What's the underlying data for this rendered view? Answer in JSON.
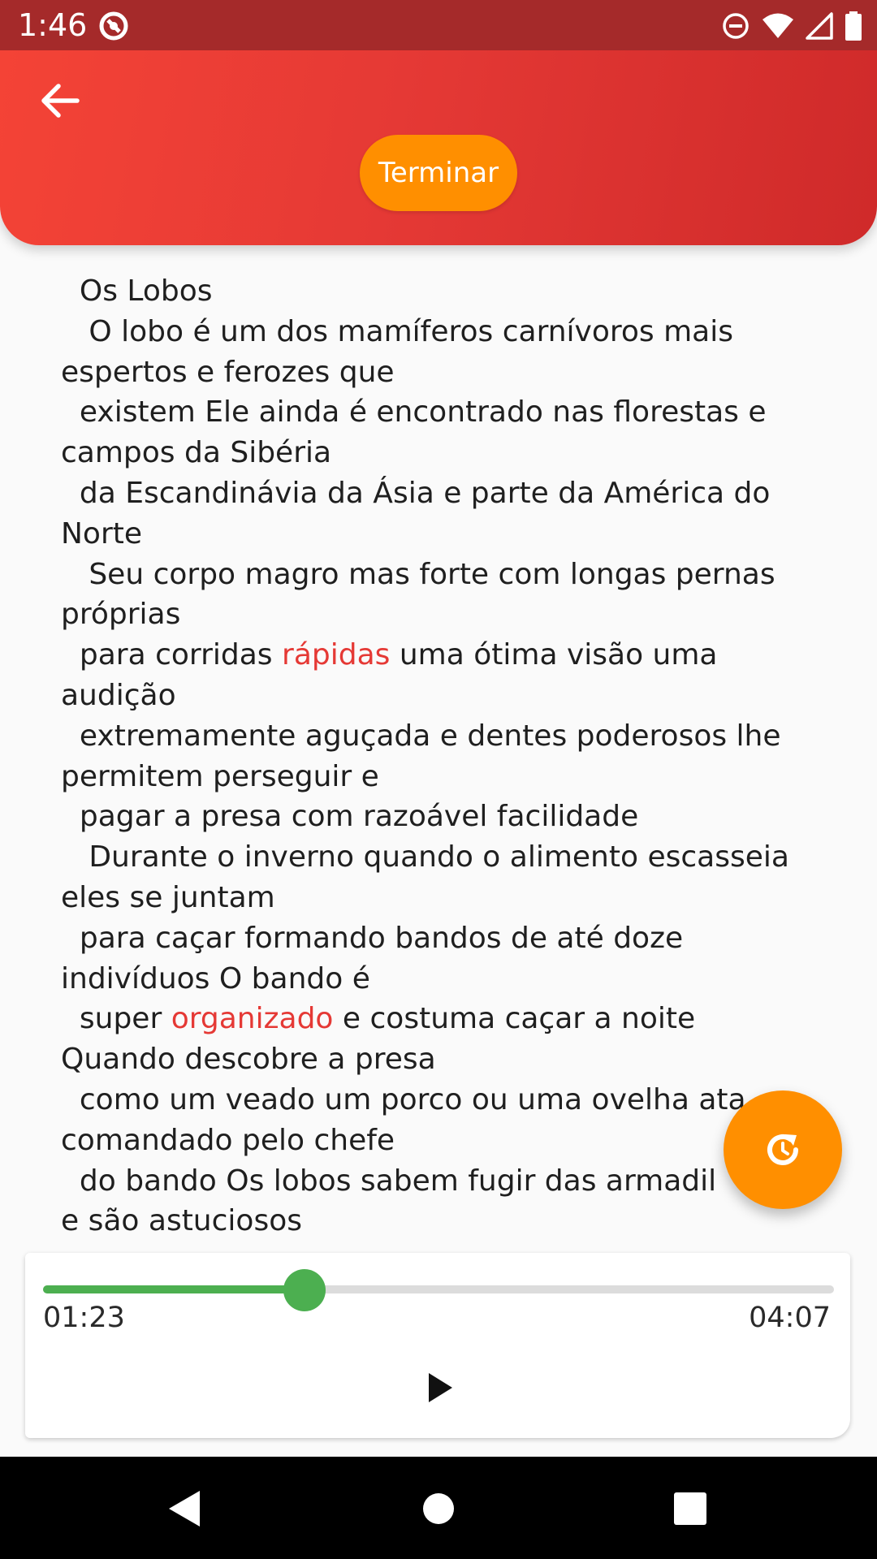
{
  "status_bar": {
    "time": "1:46",
    "background": "#a52a2a",
    "icons": [
      "app-notification-icon",
      "do-not-disturb-icon",
      "wifi-icon",
      "signal-icon",
      "battery-icon"
    ]
  },
  "app_bar": {
    "back_icon": "arrow-left-icon",
    "finish_label": "Terminar",
    "gradient": [
      "#f44336",
      "#cf2a2a"
    ],
    "finish_color": "#ff8f00"
  },
  "story": {
    "highlight_color": "#e53935",
    "lines": [
      "  Os Lobos",
      "   O lobo é um dos mamíferos carnívoros mais",
      "espertos e ferozes que",
      "  existem Ele ainda é encontrado nas florestas e",
      "campos da Sibéria",
      "  da Escandinávia da Ásia e parte da América do",
      "Norte",
      "   Seu corpo magro mas forte com longas pernas",
      "próprias",
      "  para corridas |rápidas| uma ótima visão uma",
      "audição",
      "  extremamente aguçada e dentes poderosos lhe",
      "permitem perseguir e",
      "  pagar a presa com razoável facilidade",
      "   Durante o inverno quando o alimento escasseia",
      "eles se juntam",
      "  para caçar formando bandos de até doze",
      "indivíduos O bando é",
      "  super |organizado| e costuma caçar a noite",
      "Quando descobre a presa",
      "  como um veado um porco ou uma ovelha ata",
      "comandado pelo chefe",
      "  do bando Os lobos sabem fugir das armadil",
      "e são astuciosos"
    ]
  },
  "fab": {
    "icon": "replay-icon",
    "color": "#ff8f00"
  },
  "player": {
    "elapsed": "01:23",
    "duration": "04:07",
    "progress": 0.3305,
    "progress_color": "#4caf50",
    "play_icon": "play-icon"
  },
  "nav_bar": {
    "icons": [
      "nav-back-icon",
      "nav-home-icon",
      "nav-recents-icon"
    ]
  }
}
